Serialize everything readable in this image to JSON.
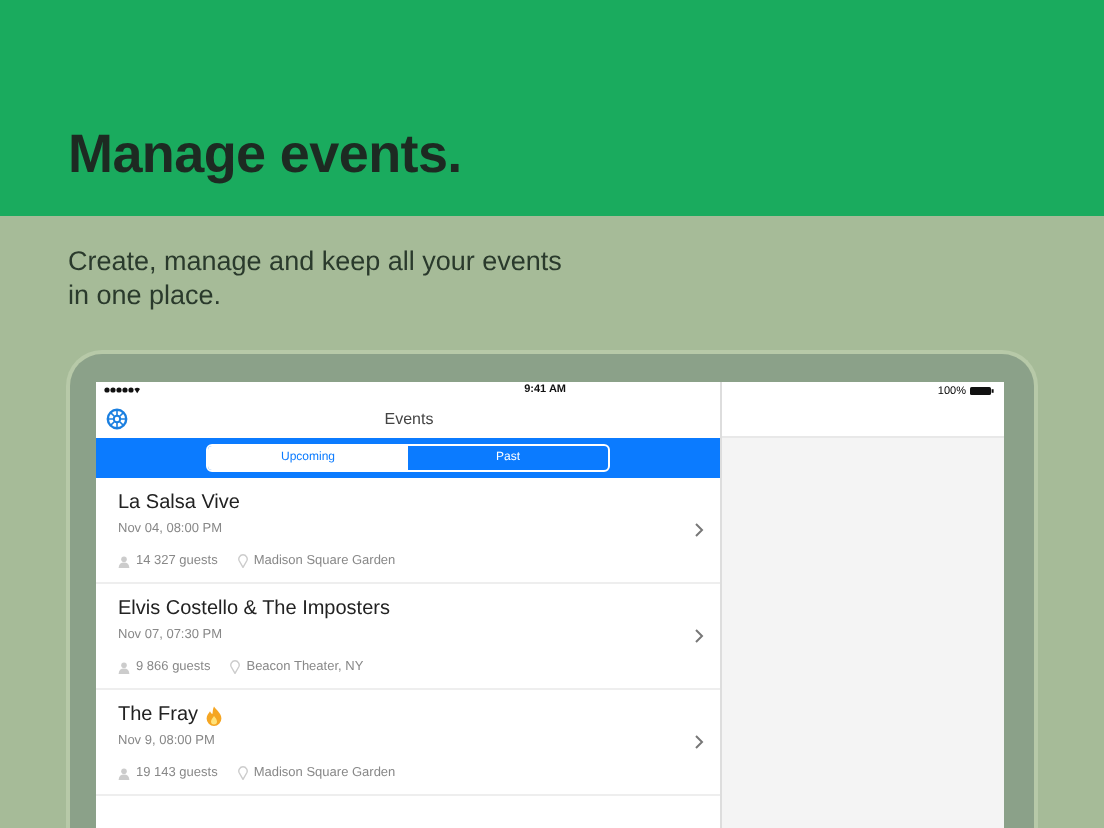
{
  "hero": {
    "title": "Manage events.",
    "subtitle": "Create, manage and keep all your events in one place."
  },
  "status_bar": {
    "time": "9:41 AM",
    "battery": "100%"
  },
  "nav": {
    "title": "Events"
  },
  "segments": [
    {
      "label": "Upcoming",
      "selected": true
    },
    {
      "label": "Past",
      "selected": false
    }
  ],
  "events": [
    {
      "name": "La Salsa Vive",
      "hot": false,
      "date": "Nov 04, 08:00 PM",
      "guests": "14 327 guests",
      "venue": "Madison Square Garden"
    },
    {
      "name": "Elvis Costello & The Imposters",
      "hot": false,
      "date": "Nov 07, 07:30 PM",
      "guests": "9 866 guests",
      "venue": "Beacon Theater, NY"
    },
    {
      "name": "The Fray",
      "hot": true,
      "date": "Nov 9, 08:00 PM",
      "guests": "19 143 guests",
      "venue": "Madison Square Garden"
    }
  ]
}
